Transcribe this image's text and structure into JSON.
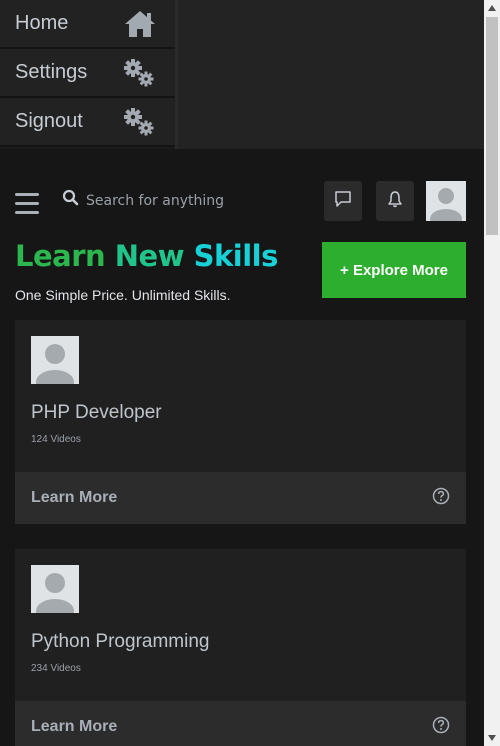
{
  "sidemenu": {
    "items": [
      {
        "label": "Home",
        "icon": "home-icon"
      },
      {
        "label": "Settings",
        "icon": "gears-icon"
      },
      {
        "label": "Signout",
        "icon": "gears-icon"
      }
    ]
  },
  "topbar": {
    "search_placeholder": "Search for anything",
    "icons": [
      "menu-icon",
      "search-icon",
      "message-icon",
      "bell-icon",
      "avatar"
    ]
  },
  "hero": {
    "title_word1": "Learn",
    "title_word2": "New",
    "title_word3": "Skills",
    "subtitle": "One Simple Price. Unlimited Skills.",
    "explore_button": "+ Explore More"
  },
  "courses": [
    {
      "title": "PHP Developer",
      "count": "124 Videos",
      "cta": "Learn More"
    },
    {
      "title": "Python Programming",
      "count": "234 Videos",
      "cta": "Learn More"
    }
  ],
  "colors": {
    "accent_green": "#2eae2f",
    "title_green": "#2cb64e",
    "title_teal": "#1fc58a",
    "title_cyan": "#18d1d6"
  }
}
